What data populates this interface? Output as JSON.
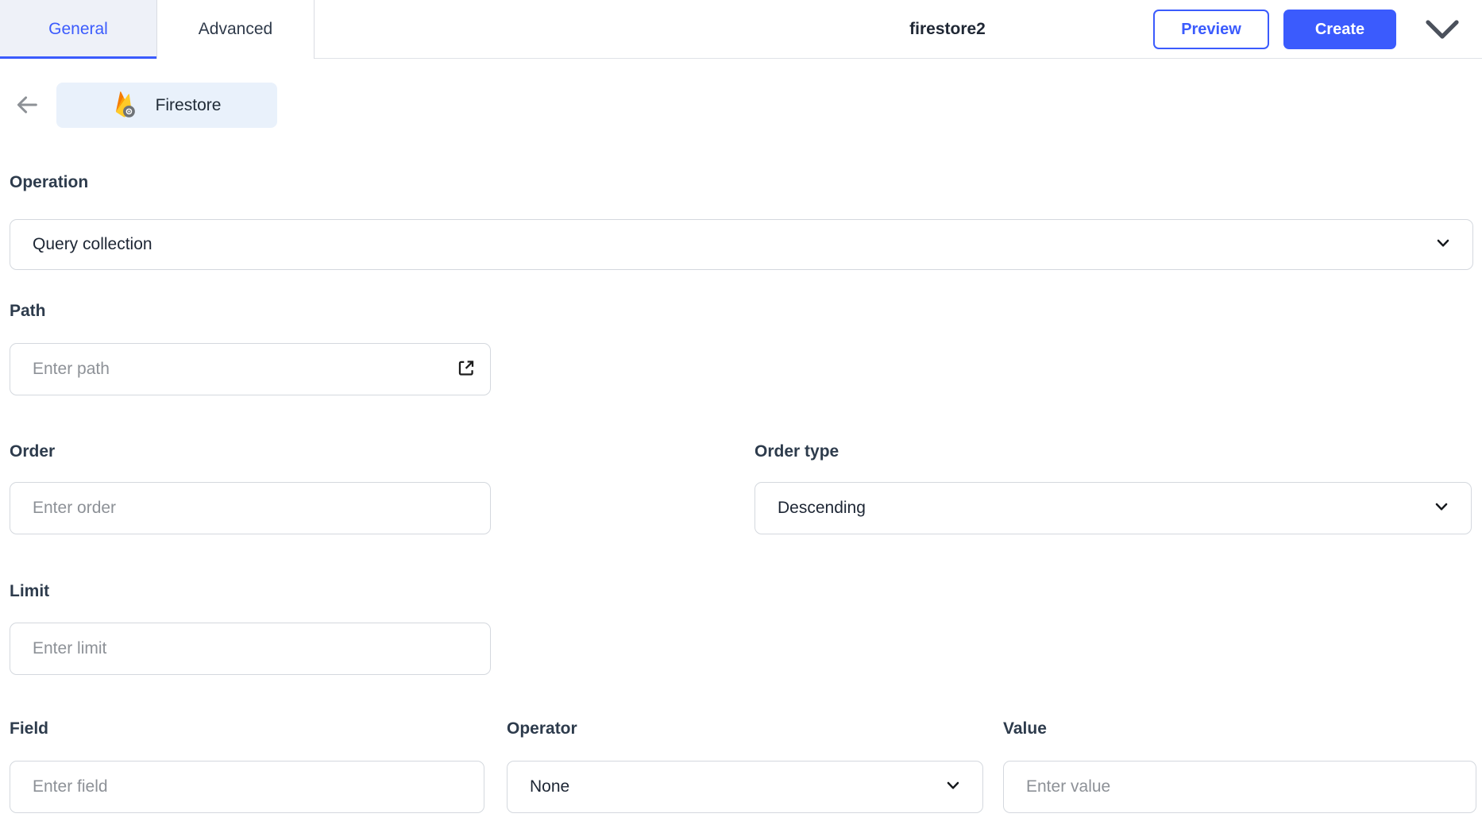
{
  "header": {
    "tabs": [
      {
        "label": "General",
        "active": true
      },
      {
        "label": "Advanced",
        "active": false
      }
    ],
    "title": "firestore2",
    "buttons": {
      "preview": "Preview",
      "create": "Create"
    }
  },
  "datasource": {
    "chip_label": "Firestore"
  },
  "form": {
    "operation": {
      "label": "Operation",
      "value": "Query collection"
    },
    "path": {
      "label": "Path",
      "placeholder": "Enter path"
    },
    "order": {
      "label": "Order",
      "placeholder": "Enter order"
    },
    "order_type": {
      "label": "Order type",
      "value": "Descending"
    },
    "limit": {
      "label": "Limit",
      "placeholder": "Enter limit"
    },
    "field": {
      "label": "Field",
      "placeholder": "Enter field"
    },
    "operator": {
      "label": "Operator",
      "value": "None"
    },
    "value": {
      "label": "Value",
      "placeholder": "Enter value"
    }
  },
  "colors": {
    "accent": "#3b5bfd",
    "active_tab_bg": "#eef1f8",
    "chip_bg": "#e9f1fb",
    "label_text": "#2d3b4c",
    "value_text": "#1d2634",
    "placeholder_text": "#8d9197",
    "input_border": "#d4d8de",
    "header_border": "#dfe2e7"
  }
}
